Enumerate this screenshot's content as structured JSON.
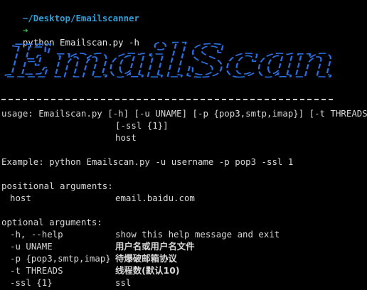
{
  "prompt": {
    "path": "~/Desktop/Emailscanner",
    "arrow": "➜",
    "command": "python Emailscan.py -h"
  },
  "banner": {
    "text": "EmailScan",
    "color": "#2a6fe0"
  },
  "usage": {
    "line1": "usage: Emailscan.py [-h] [-u UNAME] [-p {pop3,smtp,imap}] [-t THREADS]",
    "line2": "[-ssl {1}]",
    "line3": "host"
  },
  "example": "Example: python Emailscan.py -u username -p pop3 -ssl 1",
  "positional": {
    "header": "positional arguments:",
    "args": [
      {
        "name": "host",
        "desc": "email.baidu.com"
      }
    ]
  },
  "optional": {
    "header": "optional arguments:",
    "args": [
      {
        "name": "-h, --help",
        "desc": "show this help message and exit"
      },
      {
        "name": "-u UNAME",
        "desc": "用户名或用户名文件"
      },
      {
        "name": "-p {pop3,smtp,imap}",
        "desc": "待爆破邮箱协议"
      },
      {
        "name": "-t THREADS",
        "desc": "线程数(默认10)"
      },
      {
        "name": "-ssl {1}",
        "desc": "ssl"
      }
    ]
  }
}
